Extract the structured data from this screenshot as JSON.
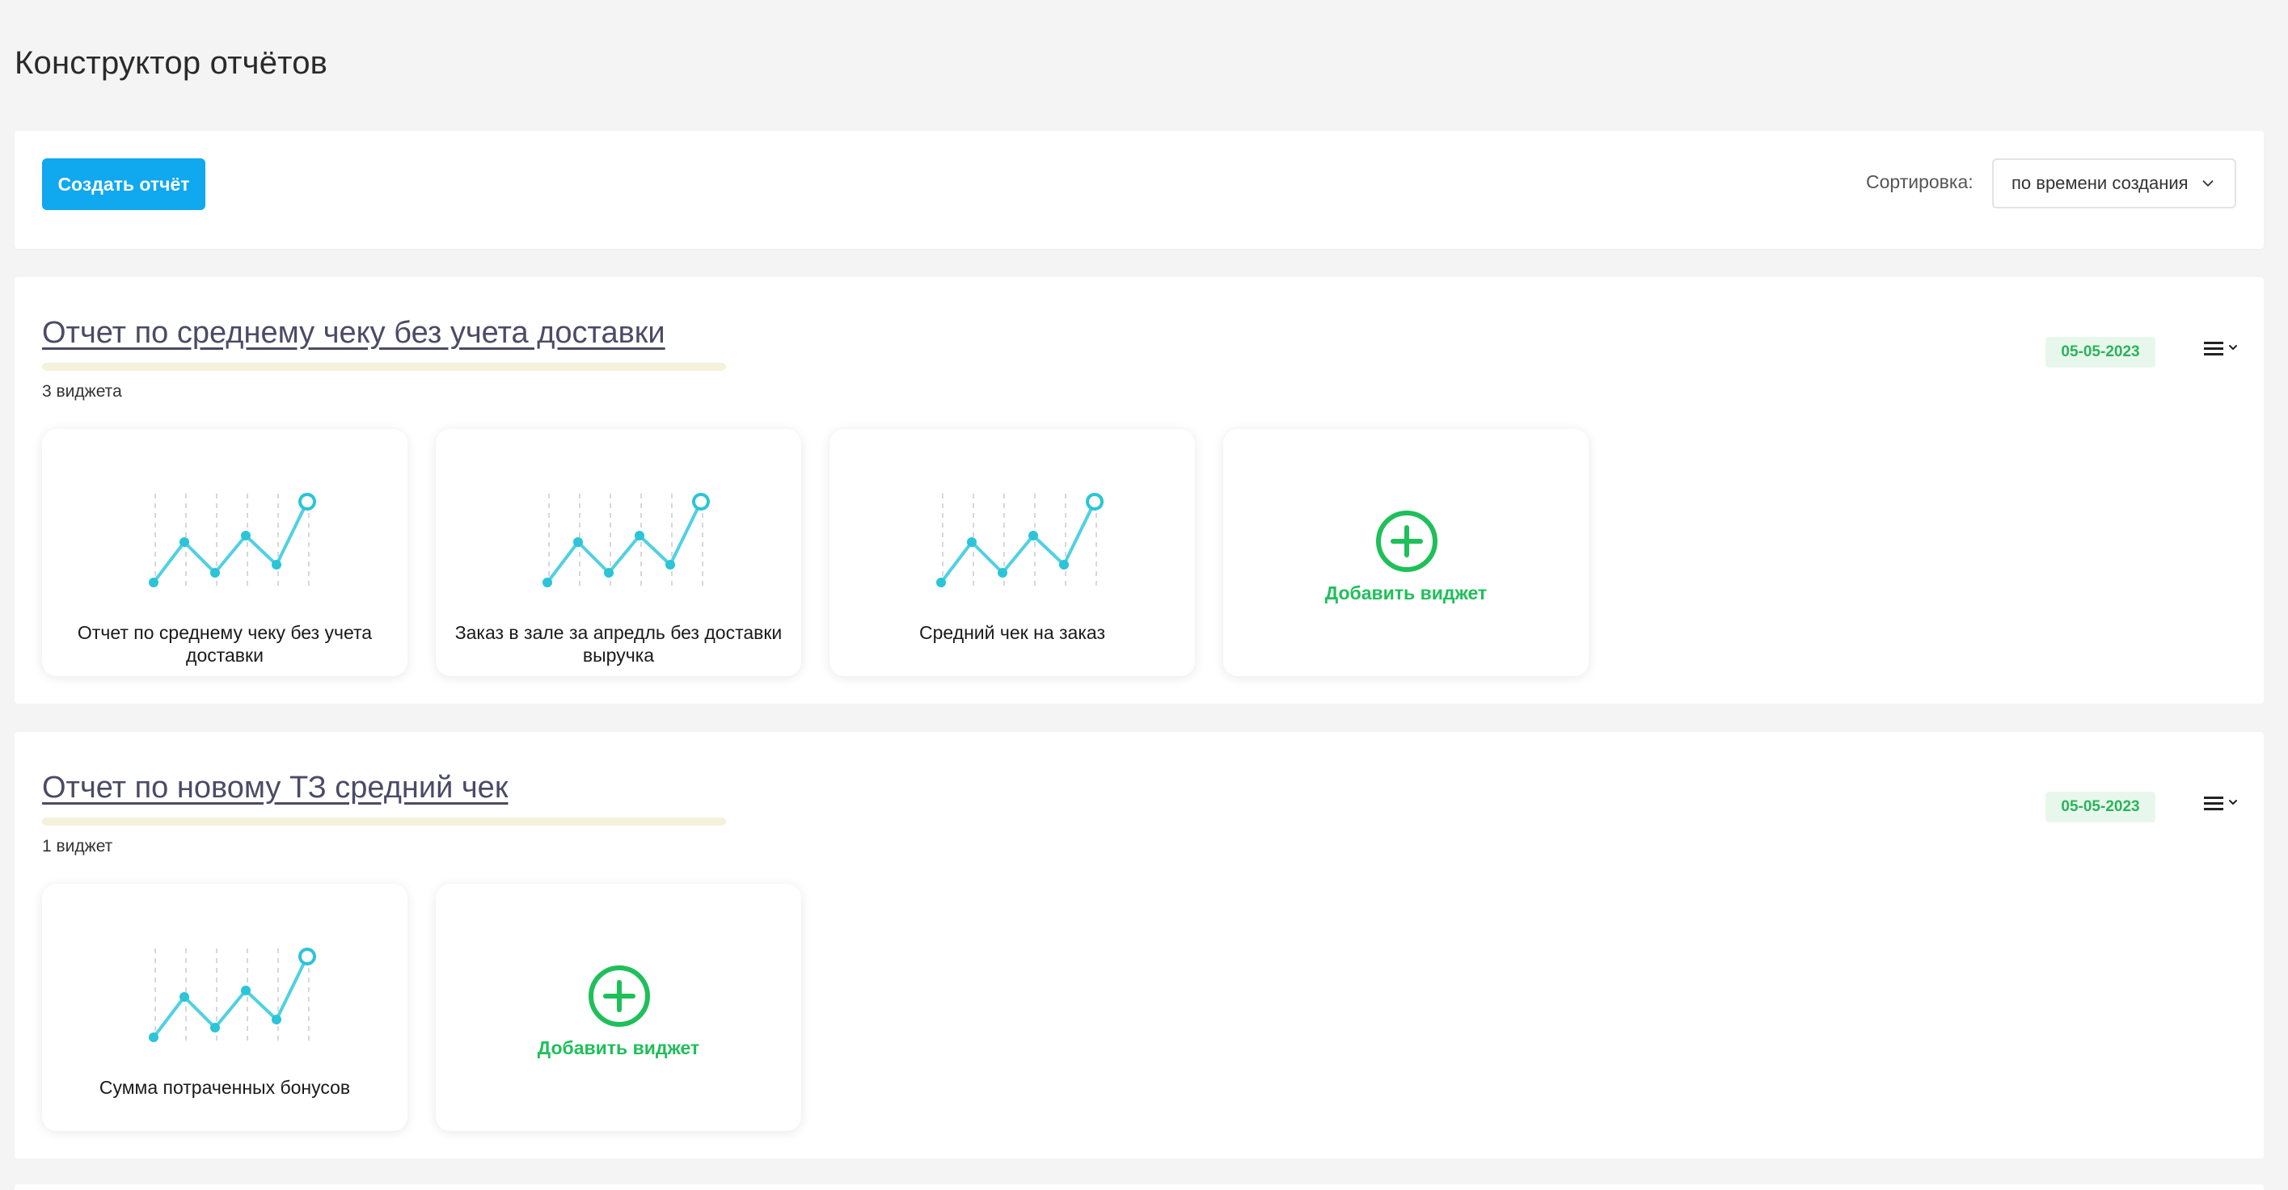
{
  "page": {
    "title": "Конструктор отчётов"
  },
  "toolbar": {
    "create_label": "Создать отчёт",
    "sort_label": "Сортировка:",
    "sort_value": "по времени создания"
  },
  "colors": {
    "accent_blue": "#10a8ee",
    "add_green": "#1fbf5a",
    "chart_line": "#4fd1e2",
    "date_text": "#2bb35c",
    "title_text": "#4b4b66"
  },
  "reports": [
    {
      "title": "Отчет по среднему чеку без учета доставки",
      "widget_count": "3 виджета",
      "date": "05-05-2023",
      "widgets": [
        {
          "label": "Отчет по среднему чеку без учета доставки",
          "icon": "line-chart-icon"
        },
        {
          "label": "Заказ в зале за апредль без доставки выручка",
          "icon": "line-chart-icon"
        },
        {
          "label": "Средний чек на заказ",
          "icon": "line-chart-icon"
        }
      ],
      "add_widget_label": "Добавить виджет"
    },
    {
      "title": "Отчет по новому ТЗ средний чек",
      "widget_count": "1 виджет",
      "date": "05-05-2023",
      "widgets": [
        {
          "label": "Сумма потраченных бонусов",
          "icon": "line-chart-icon"
        }
      ],
      "add_widget_label": "Добавить виджет"
    }
  ]
}
